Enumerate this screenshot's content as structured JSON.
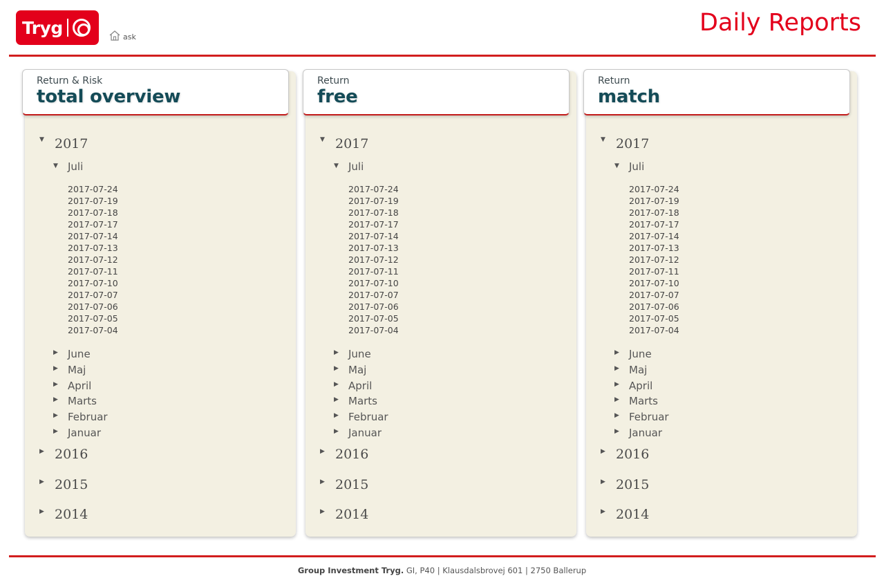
{
  "logo": {
    "text": "Tryg"
  },
  "nav": {
    "home_label": "ask"
  },
  "header": {
    "title": "Daily Reports"
  },
  "panels": [
    {
      "subtitle": "Return & Risk",
      "name": "total overview",
      "open_year": "2017",
      "open_month": "Juli",
      "dates": [
        "2017-07-24",
        "2017-07-19",
        "2017-07-18",
        "2017-07-17",
        "2017-07-14",
        "2017-07-13",
        "2017-07-12",
        "2017-07-11",
        "2017-07-10",
        "2017-07-07",
        "2017-07-06",
        "2017-07-05",
        "2017-07-04"
      ],
      "other_months": [
        "June",
        "Maj",
        "April",
        "Marts",
        "Februar",
        "Januar"
      ],
      "other_years": [
        "2016",
        "2015",
        "2014"
      ]
    },
    {
      "subtitle": "Return",
      "name": "free",
      "open_year": "2017",
      "open_month": "Juli",
      "dates": [
        "2017-07-24",
        "2017-07-19",
        "2017-07-18",
        "2017-07-17",
        "2017-07-14",
        "2017-07-13",
        "2017-07-12",
        "2017-07-11",
        "2017-07-10",
        "2017-07-07",
        "2017-07-06",
        "2017-07-05",
        "2017-07-04"
      ],
      "other_months": [
        "June",
        "Maj",
        "April",
        "Marts",
        "Februar",
        "Januar"
      ],
      "other_years": [
        "2016",
        "2015",
        "2014"
      ]
    },
    {
      "subtitle": "Return",
      "name": "match",
      "open_year": "2017",
      "open_month": "Juli",
      "dates": [
        "2017-07-24",
        "2017-07-19",
        "2017-07-18",
        "2017-07-17",
        "2017-07-14",
        "2017-07-13",
        "2017-07-12",
        "2017-07-11",
        "2017-07-10",
        "2017-07-07",
        "2017-07-06",
        "2017-07-05",
        "2017-07-04"
      ],
      "other_months": [
        "June",
        "Maj",
        "April",
        "Marts",
        "Februar",
        "Januar"
      ],
      "other_years": [
        "2016",
        "2015",
        "2014"
      ]
    }
  ],
  "footer": {
    "org": "Group Investment Tryg.",
    "address": "GI, P40 | Klausdalsbrovej 601 | 2750 Ballerup"
  }
}
